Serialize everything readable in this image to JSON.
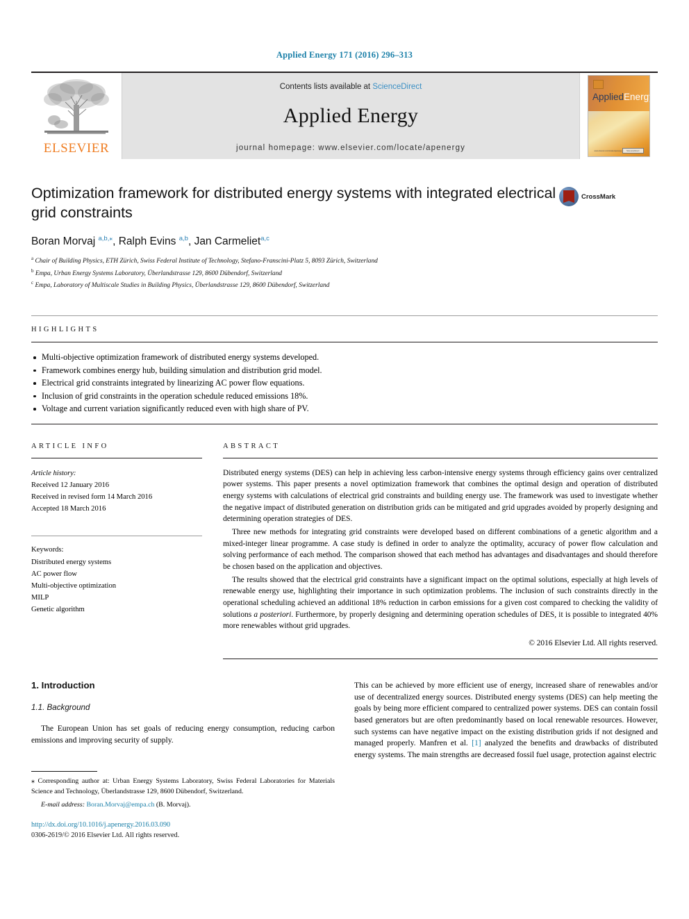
{
  "journal_citation": "Applied Energy 171 (2016) 296–313",
  "header": {
    "contents_prefix": "Contents lists available at ",
    "sciencedirect": "ScienceDirect",
    "journal_name": "Applied Energy",
    "homepage": "journal homepage: www.elsevier.com/locate/apenergy",
    "publisher_logo_text": "ELSEVIER",
    "cover": {
      "title_part1": "Applied",
      "title_part2": "Energy",
      "footer_line": "www.elsevier.com/locate/apenergy",
      "footer_badge": "ScienceDirect"
    },
    "accent_link_color": "#3a8fc4",
    "elsevier_orange": "#ef7d22",
    "band_background": "#e3e3e3"
  },
  "article": {
    "title": "Optimization framework for distributed energy systems with integrated electrical grid constraints",
    "crossmark_label": "CrossMark",
    "authors_html": "Boran Morvaj <sup>a,b,⁎</sup>, Ralph Evins <sup>a,b</sup>, Jan Carmeliet<sup>a,c</sup>",
    "affiliations": [
      "Chair of Building Physics, ETH Zürich, Swiss Federal Institute of Technology, Stefano-Franscini-Platz 5, 8093 Zürich, Switzerland",
      "Empa, Urban Energy Systems Laboratory, Überlandstrasse 129, 8600 Dübendorf, Switzerland",
      "Empa, Laboratory of Multiscale Studies in Building Physics, Überlandstrasse 129, 8600 Dübendorf, Switzerland"
    ],
    "affiliation_markers": [
      "a",
      "b",
      "c"
    ]
  },
  "highlights": {
    "label": "HIGHLIGHTS",
    "items": [
      "Multi-objective optimization framework of distributed energy systems developed.",
      "Framework combines energy hub, building simulation and distribution grid model.",
      "Electrical grid constraints integrated by linearizing AC power flow equations.",
      "Inclusion of grid constraints in the operation schedule reduced emissions 18%.",
      "Voltage and current variation significantly reduced even with high share of PV."
    ]
  },
  "article_info": {
    "label": "ARTICLE INFO",
    "history_label": "Article history:",
    "history": [
      "Received 12 January 2016",
      "Received in revised form 14 March 2016",
      "Accepted 18 March 2016"
    ],
    "keywords_label": "Keywords:",
    "keywords": [
      "Distributed energy systems",
      "AC power flow",
      "Multi-objective optimization",
      "MILP",
      "Genetic algorithm"
    ]
  },
  "abstract": {
    "label": "ABSTRACT",
    "paragraphs": [
      "Distributed energy systems (DES) can help in achieving less carbon-intensive energy systems through efficiency gains over centralized power systems. This paper presents a novel optimization framework that combines the optimal design and operation of distributed energy systems with calculations of electrical grid constraints and building energy use. The framework was used to investigate whether the negative impact of distributed generation on distribution grids can be mitigated and grid upgrades avoided by properly designing and determining operation strategies of DES.",
      "Three new methods for integrating grid constraints were developed based on different combinations of a genetic algorithm and a mixed-integer linear programme. A case study is defined in order to analyze the optimality, accuracy of power flow calculation and solving performance of each method. The comparison showed that each method has advantages and disadvantages and should therefore be chosen based on the application and objectives."
    ],
    "paragraph3_part1": "The results showed that the electrical grid constraints have a significant impact on the optimal solutions, especially at high levels of renewable energy use, highlighting their importance in such optimization problems. The inclusion of such constraints directly in the operational scheduling achieved an additional 18% reduction in carbon emissions for a given cost compared to checking the validity of solutions ",
    "paragraph3_italic": "a posteriori",
    "paragraph3_part2": ". Furthermore, by properly designing and determining operation schedules of DES, it is possible to integrated 40% more renewables without grid upgrades.",
    "copyright": "© 2016 Elsevier Ltd. All rights reserved."
  },
  "body": {
    "section_number_title": "1. Introduction",
    "subsection": "1.1. Background",
    "left_paragraph": "The European Union has set goals of reducing energy consumption, reducing carbon emissions and improving security of supply.",
    "right_paragraph_part1": "This can be achieved by more efficient use of energy, increased share of renewables and/or use of decentralized energy sources. Distributed energy systems (DES) can help meeting the goals by being more efficient compared to centralized power systems. DES can contain fossil based generators but are often predominantly based on local renewable resources. However, such systems can have negative impact on the existing distribution grids if not designed and managed properly. Manfren et al. ",
    "right_citation": "[1]",
    "right_paragraph_part2": " analyzed the benefits and drawbacks of distributed energy systems. The main strengths are decreased fossil fuel usage, protection against electric"
  },
  "footnote": {
    "corresponding": "⁎ Corresponding author at: Urban Energy Systems Laboratory, Swiss Federal Laboratories for Materials Science and Technology, Überlandstrasse 129, 8600 Dübendorf, Switzerland.",
    "email_label": "E-mail address:",
    "email": "Boran.Morvaj@empa.ch",
    "email_suffix": "(B. Morvaj).",
    "doi": "http://dx.doi.org/10.1016/j.apenergy.2016.03.090",
    "issn": "0306-2619/© 2016 Elsevier Ltd. All rights reserved."
  }
}
